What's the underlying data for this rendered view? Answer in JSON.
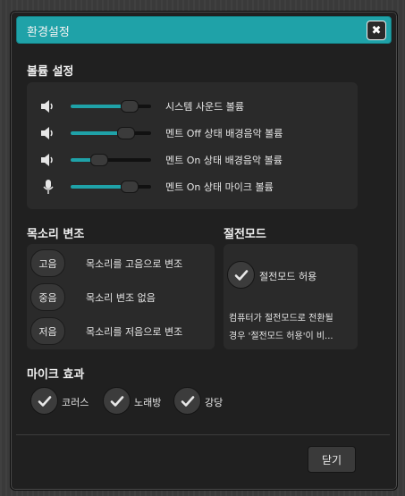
{
  "dialog": {
    "title": "환경설정",
    "close_icon": "close-icon"
  },
  "volume": {
    "heading": "볼륨 설정",
    "rows": [
      {
        "icon": "speaker-icon",
        "label": "시스템 사운드 볼륨",
        "level": 0.72
      },
      {
        "icon": "speaker-icon",
        "label": "멘트 Off 상태 배경음악 볼륨",
        "level": 0.68
      },
      {
        "icon": "speaker-icon",
        "label": "멘트 On 상태 배경음악 볼륨",
        "level": 0.34
      },
      {
        "icon": "microphone-icon",
        "label": "멘트 On 상태 마이크 볼륨",
        "level": 0.72
      }
    ]
  },
  "voice": {
    "heading": "목소리 변조",
    "options": [
      {
        "button": "고음",
        "label": "목소리를 고음으로 변조"
      },
      {
        "button": "중음",
        "label": "목소리 변조 없음"
      },
      {
        "button": "저음",
        "label": "목소리를 저음으로 변조"
      }
    ]
  },
  "power": {
    "heading": "절전모드",
    "checkbox_label": "절전모드 허용",
    "description_line1": "컴퓨터가 절전모드로 전환될",
    "description_line2": "경우 '절전모드 허용'이 비..."
  },
  "mic": {
    "heading": "마이크 효과",
    "effects": [
      {
        "label": "코러스"
      },
      {
        "label": "노래방"
      },
      {
        "label": "강당"
      }
    ]
  },
  "footer": {
    "close_label": "닫기"
  },
  "colors": {
    "accent": "#1fa2a8",
    "panel": "#2a2a2a",
    "background": "#202020"
  }
}
